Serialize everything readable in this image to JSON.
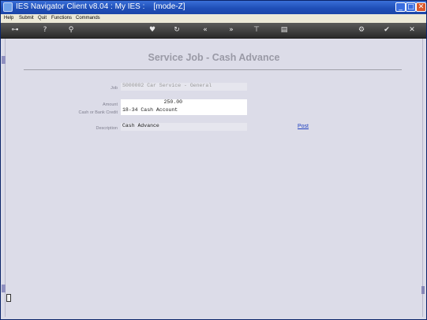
{
  "window": {
    "title": "IES Navigator Client v8.04 : My IES :    [mode-Z]",
    "minimize_glyph": "_",
    "maximize_glyph": "□",
    "close_glyph": "✕"
  },
  "menu": {
    "items": [
      "Help",
      "Submit",
      "Quit",
      "Functions",
      "Commands"
    ]
  },
  "toolbar": {
    "icons": [
      {
        "name": "key-icon",
        "glyph": "⊶"
      },
      {
        "name": "help-icon",
        "glyph": "?"
      },
      {
        "name": "search-icon",
        "glyph": "⚲"
      },
      {
        "name": "favorite-heart-icon",
        "glyph": "♥"
      },
      {
        "name": "refresh-icon",
        "glyph": "↻"
      },
      {
        "name": "back-icon",
        "glyph": "«"
      },
      {
        "name": "forward-icon",
        "glyph": "»"
      },
      {
        "name": "tree-icon",
        "glyph": "⊤"
      },
      {
        "name": "document-icon",
        "glyph": "▤"
      },
      {
        "name": "settings-icon",
        "glyph": "⚙"
      },
      {
        "name": "ok-icon",
        "glyph": "✔"
      },
      {
        "name": "cancel-icon",
        "glyph": "✕"
      }
    ]
  },
  "form": {
    "heading": "Service Job - Cash Advance",
    "job_label": "Job",
    "job_value": "S000002 Car Service - General",
    "amount_label": "Amount",
    "amount_value": "250.00",
    "cash_label": "Cash or Bank Credit",
    "cash_value": "18-34 Cash Account",
    "description_label": "Description",
    "description_value": "Cash Advance",
    "post_label": "Post"
  },
  "colors": {
    "titlebar": "#1f4fb8",
    "toolbar": "#3a3a3a",
    "content_bg": "#dcdce8",
    "link": "#2040c0"
  }
}
